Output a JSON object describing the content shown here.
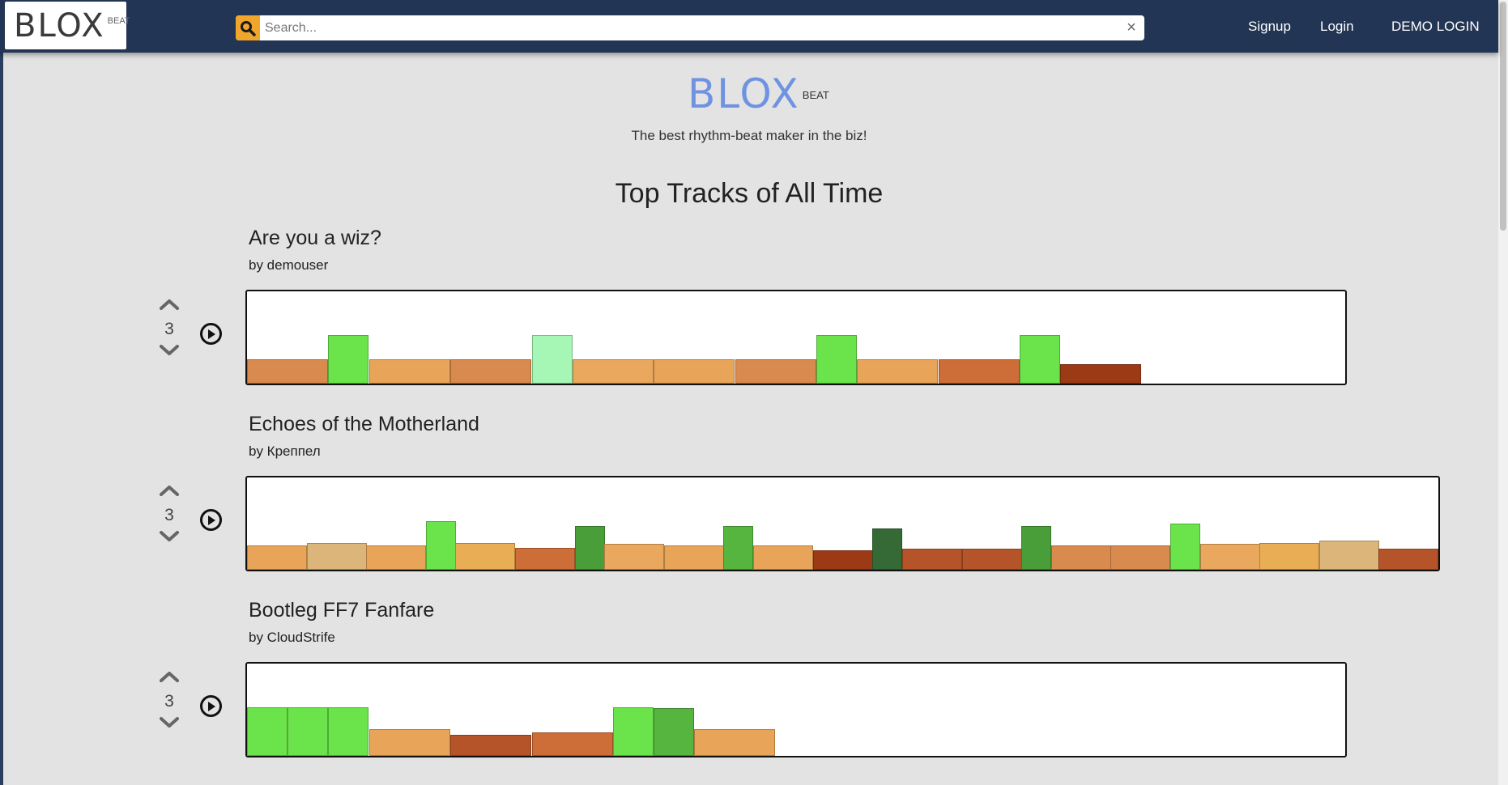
{
  "nav": {
    "logo_main": "BLOX",
    "logo_sup": "BEAT",
    "search_placeholder": "Search...",
    "search_clear": "×",
    "signup": "Signup",
    "login": "Login",
    "demo_login": "DEMO LOGIN"
  },
  "hero": {
    "logo_main": "BLOX",
    "logo_sup": "BEAT",
    "tagline": "The best rhythm-beat maker in the biz!"
  },
  "section_title": "Top Tracks of All Time",
  "colors": {
    "navbar": "#233554",
    "search_button": "#f0a52b",
    "hero_logo": "#6f93e0",
    "page_background": "#e3e3e3"
  },
  "tracks": [
    {
      "title": "Are you a wiz?",
      "author": "by demouser",
      "votes": "3",
      "blocks": [
        {
          "beats": 2,
          "color": "#d98a4e",
          "level": 1
        },
        {
          "beats": 1,
          "color": "#6be34a",
          "level": 2
        },
        {
          "beats": 2,
          "color": "#e8a458",
          "level": 1
        },
        {
          "beats": 2,
          "color": "#d98a4e",
          "level": 1
        },
        {
          "beats": 1,
          "color": "#a6f7b5",
          "level": 2
        },
        {
          "beats": 2,
          "color": "#e9a85d",
          "level": 1
        },
        {
          "beats": 2,
          "color": "#e8a458",
          "level": 1
        },
        {
          "beats": 2,
          "color": "#d98a4e",
          "level": 1
        },
        {
          "beats": 1,
          "color": "#6be34a",
          "level": 2
        },
        {
          "beats": 2,
          "color": "#e8a458",
          "level": 1
        },
        {
          "beats": 2,
          "color": "#cd6d38",
          "level": 1
        },
        {
          "beats": 1,
          "color": "#6be34a",
          "level": 2
        },
        {
          "beats": 2,
          "color": "#9c3a16",
          "level": 0.8
        }
      ],
      "total_beats": 27
    },
    {
      "title": "Echoes of the Motherland",
      "author": "by Креппел",
      "votes": "3",
      "blocks": [
        {
          "beats": 1,
          "color": "#e8a458",
          "level": 1
        },
        {
          "beats": 1,
          "color": "#dcb57a",
          "level": 1.1
        },
        {
          "beats": 1,
          "color": "#e8a458",
          "level": 1
        },
        {
          "beats": 0.5,
          "color": "#6be34a",
          "level": 2
        },
        {
          "beats": 1,
          "color": "#e9ad55",
          "level": 1.1
        },
        {
          "beats": 1,
          "color": "#cd6d38",
          "level": 0.9
        },
        {
          "beats": 0.5,
          "color": "#4a9e3a",
          "level": 1.8
        },
        {
          "beats": 1,
          "color": "#e9a85d",
          "level": 1.05
        },
        {
          "beats": 1,
          "color": "#e8a458",
          "level": 1
        },
        {
          "beats": 0.5,
          "color": "#55b53f",
          "level": 1.8
        },
        {
          "beats": 1,
          "color": "#e8a458",
          "level": 1
        },
        {
          "beats": 1,
          "color": "#9c3a16",
          "level": 0.8
        },
        {
          "beats": 0.5,
          "color": "#356a36",
          "level": 1.7
        },
        {
          "beats": 1,
          "color": "#b55428",
          "level": 0.85
        },
        {
          "beats": 1,
          "color": "#b55428",
          "level": 0.85
        },
        {
          "beats": 0.5,
          "color": "#4a9e3a",
          "level": 1.8
        },
        {
          "beats": 1,
          "color": "#d98a4e",
          "level": 1
        },
        {
          "beats": 1,
          "color": "#d98a4e",
          "level": 1
        },
        {
          "beats": 0.5,
          "color": "#6be34a",
          "level": 1.9
        },
        {
          "beats": 1,
          "color": "#e9a85d",
          "level": 1.05
        },
        {
          "beats": 1,
          "color": "#e9ad55",
          "level": 1.1
        },
        {
          "beats": 1,
          "color": "#dcb57a",
          "level": 1.2
        },
        {
          "beats": 1,
          "color": "#b55428",
          "level": 0.85
        }
      ],
      "total_beats": 20
    },
    {
      "title": "Bootleg FF7 Fanfare",
      "author": "by CloudStrife",
      "votes": "3",
      "blocks": [
        {
          "beats": 1,
          "color": "#6be34a",
          "level": 2
        },
        {
          "beats": 1,
          "color": "#6be34a",
          "level": 2
        },
        {
          "beats": 1,
          "color": "#6be34a",
          "level": 2
        },
        {
          "beats": 2,
          "color": "#e8a458",
          "level": 1.1
        },
        {
          "beats": 2,
          "color": "#b55428",
          "level": 0.85
        },
        {
          "beats": 2,
          "color": "#cd6d38",
          "level": 0.95
        },
        {
          "beats": 1,
          "color": "#6be34a",
          "level": 2
        },
        {
          "beats": 1,
          "color": "#55b53f",
          "level": 1.95
        },
        {
          "beats": 2,
          "color": "#e8a458",
          "level": 1.1
        }
      ],
      "total_beats": 27
    }
  ]
}
